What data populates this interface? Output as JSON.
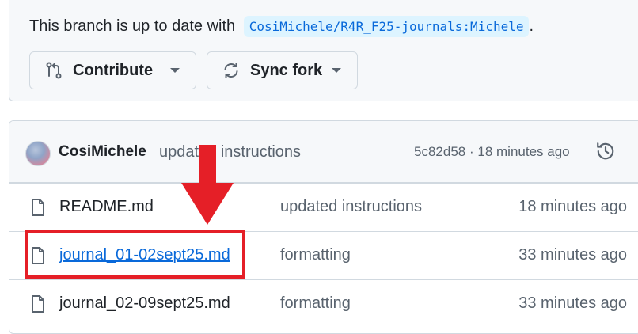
{
  "branch_status": {
    "text": "This branch is up to date with",
    "branch_ref": "CosiMichele/R4R_F25-journals:Michele",
    "suffix": "."
  },
  "buttons": {
    "contribute": {
      "label": "Contribute",
      "icon": "git-compare-icon"
    },
    "sync": {
      "label": "Sync fork",
      "icon": "sync-icon"
    }
  },
  "latest_commit": {
    "author": "CosiMichele",
    "message": "updated instructions",
    "hash": "5c82d58",
    "separator": "·",
    "time": "18 minutes ago",
    "icon": "history-icon"
  },
  "files": [
    {
      "name": "README.md",
      "commit_message": "updated instructions",
      "time": "18 minutes ago",
      "icon": "file-icon"
    },
    {
      "name": "journal_01-02sept25.md",
      "commit_message": "formatting",
      "time": "33 minutes ago",
      "icon": "file-icon"
    },
    {
      "name": "journal_02-09sept25.md",
      "commit_message": "formatting",
      "time": "33 minutes ago",
      "icon": "file-icon"
    }
  ],
  "annotation": {
    "color": "#e51f27"
  }
}
